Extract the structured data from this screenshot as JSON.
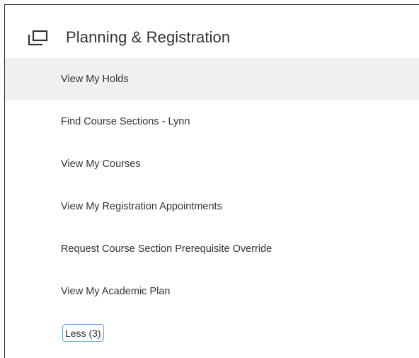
{
  "section": {
    "icon": "windows-stack-icon",
    "title": "Planning & Registration"
  },
  "menu": {
    "items": [
      {
        "label": "View My Holds",
        "state": "hovered"
      },
      {
        "label": "Find Course Sections - Lynn"
      },
      {
        "label": "View My Courses"
      },
      {
        "label": "View My Registration Appointments"
      },
      {
        "label": "Request Course Section Prerequisite Override"
      },
      {
        "label": "View My Academic Plan"
      }
    ]
  },
  "toggle": {
    "less_label": "Less (3)"
  },
  "colors": {
    "hover_row": "#eef0f2",
    "text": "#333333",
    "focus_border": "#6aa3df",
    "border": "#2b2b2b"
  }
}
